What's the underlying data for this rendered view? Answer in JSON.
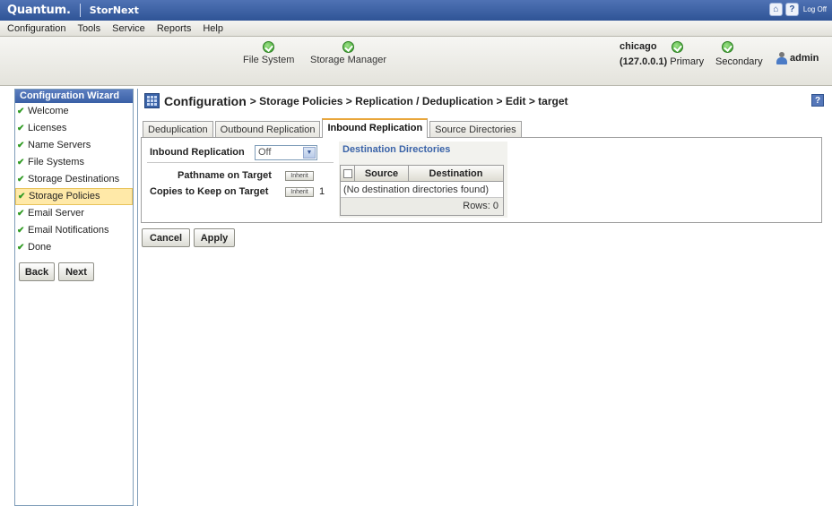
{
  "titlebar": {
    "brand": "Quantum.",
    "product": "StorNext",
    "logoff": "Log Off",
    "home_glyph": "⌂",
    "help_glyph": "?"
  },
  "menu": [
    "Configuration",
    "Tools",
    "Service",
    "Reports",
    "Help"
  ],
  "status": {
    "file_system": "File System",
    "storage_manager": "Storage Manager",
    "host": "chicago",
    "ip": "(127.0.0.1)",
    "primary": "Primary",
    "secondary": "Secondary",
    "user": "admin"
  },
  "wizard": {
    "title": "Configuration Wizard",
    "items": [
      {
        "label": "Welcome",
        "done": true
      },
      {
        "label": "Licenses",
        "done": true
      },
      {
        "label": "Name Servers",
        "done": true
      },
      {
        "label": "File Systems",
        "done": true
      },
      {
        "label": "Storage Destinations",
        "done": true
      },
      {
        "label": "Storage Policies",
        "done": true,
        "active": true
      },
      {
        "label": "Email Server",
        "done": true
      },
      {
        "label": "Email Notifications",
        "done": true
      },
      {
        "label": "Done",
        "done": true
      }
    ],
    "back": "Back",
    "next": "Next"
  },
  "page": {
    "title": "Configuration",
    "breadcrumb": "> Storage Policies > Replication / Deduplication > Edit > target",
    "help": "?"
  },
  "tabs": [
    "Deduplication",
    "Outbound Replication",
    "Inbound Replication",
    "Source Directories"
  ],
  "active_tab": 2,
  "form": {
    "inbound_replication_label": "Inbound Replication",
    "inbound_replication_value": "Off",
    "pathname_label": "Pathname on Target",
    "copies_label": "Copies to Keep on Target",
    "inherit_label": "Inherit",
    "copies_value": "1"
  },
  "dest": {
    "title": "Destination Directories",
    "columns": [
      "Source",
      "Destination"
    ],
    "empty": "(No destination directories found)",
    "rows_footer": "Rows: 0"
  },
  "actions": {
    "cancel": "Cancel",
    "apply": "Apply"
  },
  "colors": {
    "title_bar": "#3a60a6",
    "check_green": "#2f9a22",
    "active_tab_accent": "#e9a63a",
    "active_wizard_bg": "#ffe9a8"
  }
}
